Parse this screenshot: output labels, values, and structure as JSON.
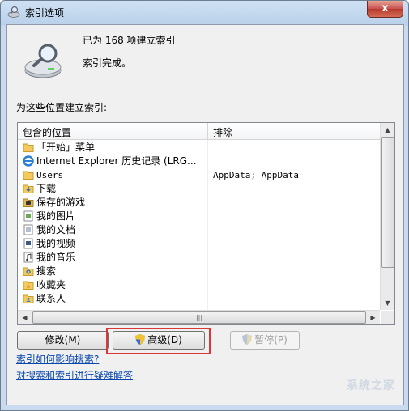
{
  "window": {
    "title": "索引选项",
    "close_glyph": "x"
  },
  "status": {
    "indexed": "已为 168 项建立索引",
    "complete": "索引完成。"
  },
  "locations_label": "为这些位置建立索引:",
  "table": {
    "headers": [
      "包含的位置",
      "排除"
    ],
    "rows": [
      {
        "icon": "folder-icon",
        "name": "「开始」菜单",
        "exclude": ""
      },
      {
        "icon": "ie-icon",
        "name": "Internet Explorer 历史记录 (LRG...",
        "exclude": ""
      },
      {
        "icon": "folder-icon",
        "name": "Users",
        "exclude": "AppData; AppData"
      },
      {
        "icon": "download-folder-icon",
        "name": "下载",
        "exclude": ""
      },
      {
        "icon": "games-folder-icon",
        "name": "保存的游戏",
        "exclude": ""
      },
      {
        "icon": "pictures-icon",
        "name": "我的图片",
        "exclude": ""
      },
      {
        "icon": "documents-icon",
        "name": "我的文档",
        "exclude": ""
      },
      {
        "icon": "videos-icon",
        "name": "我的视频",
        "exclude": ""
      },
      {
        "icon": "music-icon",
        "name": "我的音乐",
        "exclude": ""
      },
      {
        "icon": "search-folder-icon",
        "name": "搜索",
        "exclude": ""
      },
      {
        "icon": "favorites-folder-icon",
        "name": "收藏夹",
        "exclude": ""
      },
      {
        "icon": "contacts-icon",
        "name": "联系人",
        "exclude": ""
      }
    ]
  },
  "buttons": {
    "modify": "修改(M)",
    "advanced": "高级(D)",
    "pause": "暂停(P)"
  },
  "links": {
    "affect_search": "索引如何影响搜索?",
    "troubleshoot": "对搜索和索引进行疑难解答"
  },
  "watermark": "系统之家",
  "colors": {
    "link": "#0645ad",
    "highlight": "#d93838",
    "disabled": "#9c9c9c"
  }
}
